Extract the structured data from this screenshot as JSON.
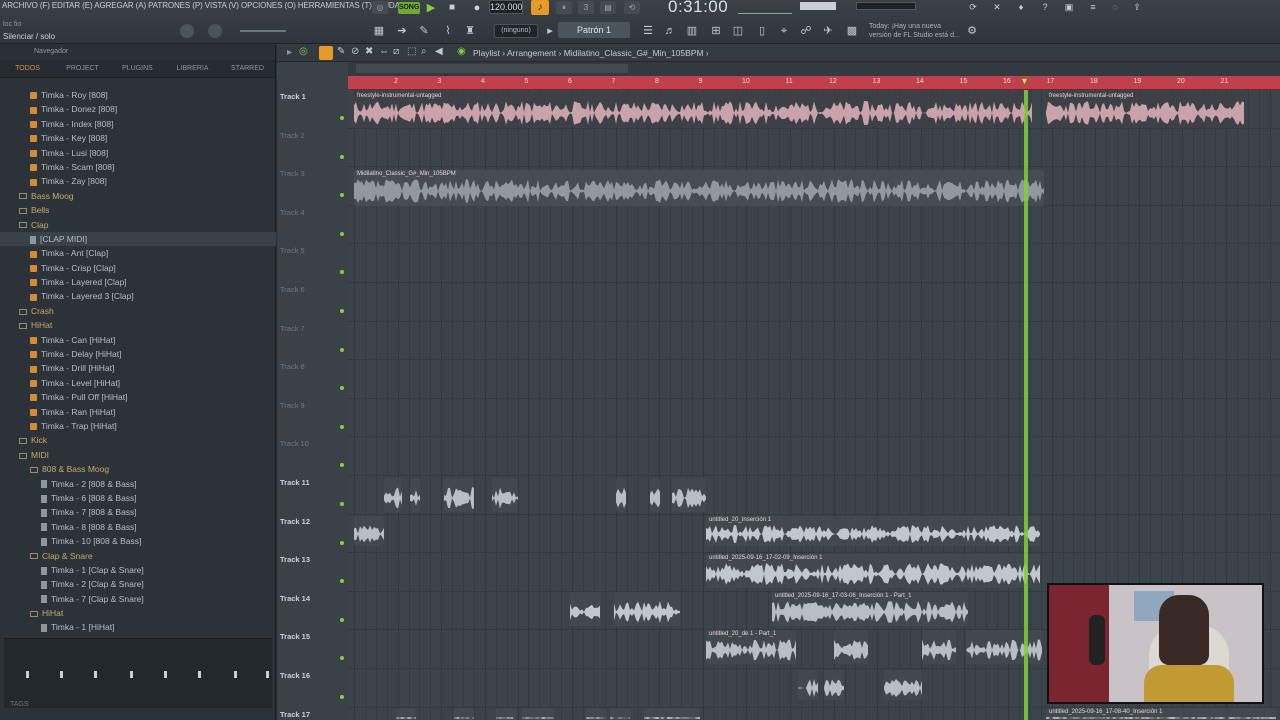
{
  "menubar": "ARCHIVO (F)  EDITAR (E)  AGREGAR (A)  PATRONES (P)  VISTA (V)  OPCIONES (O)  HERRAMIENTAS (T)  AYUDA",
  "hint1": "loc fio",
  "hint2": "Silenciar / solo",
  "transport": {
    "song_label": "SONG",
    "tempo": "120.000",
    "time": "0:31:00"
  },
  "snap_label": "(ninguno)",
  "pattern_label": "Patrón 1",
  "news_text": "Today: ¡Hay una nueva versión de FL Studio está d...",
  "browser": {
    "header": "Navegador",
    "tabs": [
      "TODOS",
      "PROJECT",
      "PLUGINS",
      "LIBRERIA",
      "STARRED"
    ],
    "items": [
      {
        "label": "Timka - Roy [808]",
        "kind": "file",
        "indent": 2
      },
      {
        "label": "Timka - Donez [808]",
        "kind": "file",
        "indent": 2
      },
      {
        "label": "Timka - Index [808]",
        "kind": "file",
        "indent": 2
      },
      {
        "label": "Timka - Key [808]",
        "kind": "file",
        "indent": 2
      },
      {
        "label": "Timka - Lusi [808]",
        "kind": "file",
        "indent": 2
      },
      {
        "label": "Timka - Scam [808]",
        "kind": "file",
        "indent": 2
      },
      {
        "label": "Timka - Zay [808]",
        "kind": "file",
        "indent": 2
      },
      {
        "label": "Bass Moog",
        "kind": "folder",
        "indent": 1
      },
      {
        "label": "Bells",
        "kind": "folder",
        "indent": 1
      },
      {
        "label": "Clap",
        "kind": "folder",
        "indent": 1
      },
      {
        "label": "[CLAP MIDI]",
        "kind": "midi",
        "indent": 2,
        "selected": true
      },
      {
        "label": "Timka - Ant [Clap]",
        "kind": "file",
        "indent": 2
      },
      {
        "label": "Timka - Crisp [Clap]",
        "kind": "file",
        "indent": 2
      },
      {
        "label": "Timka - Layered [Clap]",
        "kind": "file",
        "indent": 2
      },
      {
        "label": "Timka - Layered 3 [Clap]",
        "kind": "file",
        "indent": 2
      },
      {
        "label": "Crash",
        "kind": "folder",
        "indent": 1
      },
      {
        "label": "HiHat",
        "kind": "folder",
        "indent": 1
      },
      {
        "label": "Timka - Can [HiHat]",
        "kind": "file",
        "indent": 2
      },
      {
        "label": "Timka - Delay [HiHat]",
        "kind": "file",
        "indent": 2
      },
      {
        "label": "Timka - Drill [HiHat]",
        "kind": "file",
        "indent": 2
      },
      {
        "label": "Timka - Level [HiHat]",
        "kind": "file",
        "indent": 2
      },
      {
        "label": "Timka - Pull Off [HiHat]",
        "kind": "file",
        "indent": 2
      },
      {
        "label": "Timka - Ran [HiHat]",
        "kind": "file",
        "indent": 2
      },
      {
        "label": "Timka - Trap [HiHat]",
        "kind": "file",
        "indent": 2
      },
      {
        "label": "Kick",
        "kind": "folder",
        "indent": 1
      },
      {
        "label": "MIDI",
        "kind": "folder",
        "indent": 1
      },
      {
        "label": "808 & Bass Moog",
        "kind": "folder",
        "indent": 2
      },
      {
        "label": "Timka - 2 [808 & Bass]",
        "kind": "midi",
        "indent": 3
      },
      {
        "label": "Timka - 6 [808 & Bass]",
        "kind": "midi",
        "indent": 3
      },
      {
        "label": "Timka - 7 [808 & Bass]",
        "kind": "midi",
        "indent": 3
      },
      {
        "label": "Timka - 8 [808 & Bass]",
        "kind": "midi",
        "indent": 3
      },
      {
        "label": "Timka - 10 [808 & Bass]",
        "kind": "midi",
        "indent": 3
      },
      {
        "label": "Clap & Snare",
        "kind": "folder",
        "indent": 2
      },
      {
        "label": "Timka - 1 [Clap & Snare]",
        "kind": "midi",
        "indent": 3
      },
      {
        "label": "Timka - 2 [Clap & Snare]",
        "kind": "midi",
        "indent": 3
      },
      {
        "label": "Timka - 7 [Clap & Snare]",
        "kind": "midi",
        "indent": 3
      },
      {
        "label": "HiHat",
        "kind": "folder",
        "indent": 2
      },
      {
        "label": "Timka - 1 [HiHat]",
        "kind": "midi",
        "indent": 3
      }
    ],
    "footer_label": "TAGS"
  },
  "playlist": {
    "title": "Playlist  ›  Arrangement  ›  Midilatino_Classic_G#_Min_105BPM  ›",
    "ruler": [
      "2",
      "3",
      "4",
      "5",
      "6",
      "7",
      "8",
      "9",
      "10",
      "11",
      "12",
      "13",
      "14",
      "15",
      "16",
      "17",
      "18",
      "19",
      "20",
      "21"
    ],
    "tracks": [
      "Track 1",
      "Track 2",
      "Track 3",
      "Track 4",
      "Track 5",
      "Track 6",
      "Track 7",
      "Track 8",
      "Track 9",
      "Track 10",
      "Track 11",
      "Track 12",
      "Track 13",
      "Track 14",
      "Track 15",
      "Track 16",
      "Track 17"
    ],
    "clips": {
      "c1": "freestyle-instrumental-untagged",
      "c2": "freestyle-instrumental-untagged",
      "c3": "Midilatino_Classic_G#_Min_105BPM",
      "c4": "untitled_20_Inserción 1",
      "c5": "untitled_2025-09-16_17-02-09_Inserción 1",
      "c6": "untitled_2025-09-16_17-03-06_Inserción 1 - Part_1",
      "c7": "untitled_20_de 1 - Part_1",
      "c8": "untitled_2025-09-16_17-08-40_Inserción 1"
    }
  }
}
